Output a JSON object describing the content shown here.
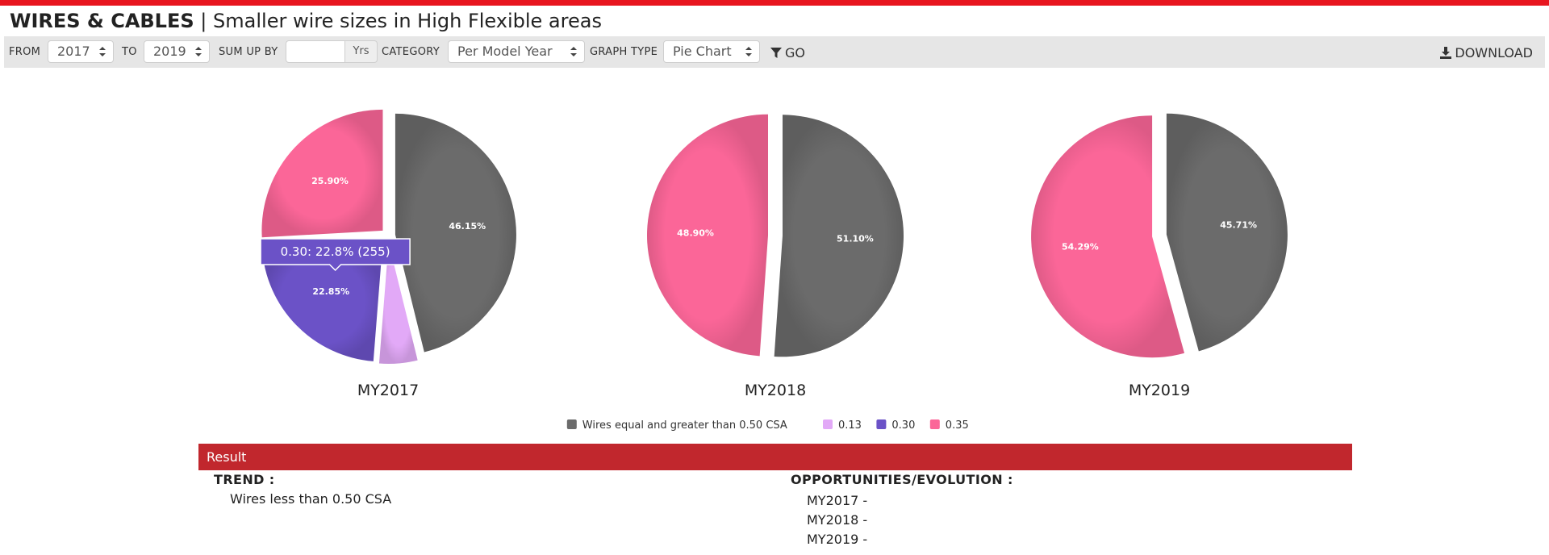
{
  "header": {
    "brand": "WIRES & CABLES",
    "separator": "|",
    "subtitle": "Smaller wire sizes in High Flexible areas"
  },
  "toolbar": {
    "from_label": "FROM",
    "from_value": "2017",
    "to_label": "TO",
    "to_value": "2019",
    "sumup_label": "SUM UP BY",
    "sumup_value": "",
    "sumup_unit": "Yrs",
    "category_label": "CATEGORY",
    "category_value": "Per Model Year",
    "graphtype_label": "GRAPH TYPE",
    "graphtype_value": "Pie Chart",
    "go_label": "GO",
    "download_label": "DOWNLOAD"
  },
  "colors": {
    "accent": "#e8161f",
    "result_bar": "#c1272d",
    "toolbar_bg": "#e6e6e6"
  },
  "chart_data": {
    "type": "pie",
    "legend": [
      {
        "name": "Wires equal and greater than 0.50 CSA",
        "color": "#6b6b6b"
      },
      {
        "name": "0.13",
        "color": "#e2a9f7"
      },
      {
        "name": "0.30",
        "color": "#6b52c7"
      },
      {
        "name": "0.35",
        "color": "#fb6698"
      }
    ],
    "legend_position": "bottom-center",
    "charts": [
      {
        "title": "MY2017",
        "slices": [
          {
            "name": "Wires equal and greater than 0.50 CSA",
            "percent": 46.15,
            "label": "46.15%"
          },
          {
            "name": "0.13",
            "percent": 5.1,
            "label": ""
          },
          {
            "name": "0.30",
            "percent": 22.85,
            "label": "22.85%"
          },
          {
            "name": "0.35",
            "percent": 25.9,
            "label": "25.90%"
          }
        ],
        "tooltip": {
          "slice": "0.30",
          "text": "0.30: 22.8% (255)"
        }
      },
      {
        "title": "MY2018",
        "slices": [
          {
            "name": "Wires equal and greater than 0.50 CSA",
            "percent": 51.1,
            "label": "51.10%"
          },
          {
            "name": "0.35",
            "percent": 48.9,
            "label": "48.90%"
          }
        ]
      },
      {
        "title": "MY2019",
        "slices": [
          {
            "name": "Wires equal and greater than 0.50 CSA",
            "percent": 45.71,
            "label": "45.71%"
          },
          {
            "name": "0.35",
            "percent": 54.29,
            "label": "54.29%"
          }
        ]
      }
    ]
  },
  "result": {
    "title": "Result",
    "trend_heading": "TREND :",
    "trend_text": "Wires less than 0.50 CSA",
    "opportunities_heading": "OPPORTUNITIES/EVOLUTION :",
    "opportunities": [
      "MY2017 -",
      "MY2018 -",
      "MY2019 -"
    ]
  }
}
